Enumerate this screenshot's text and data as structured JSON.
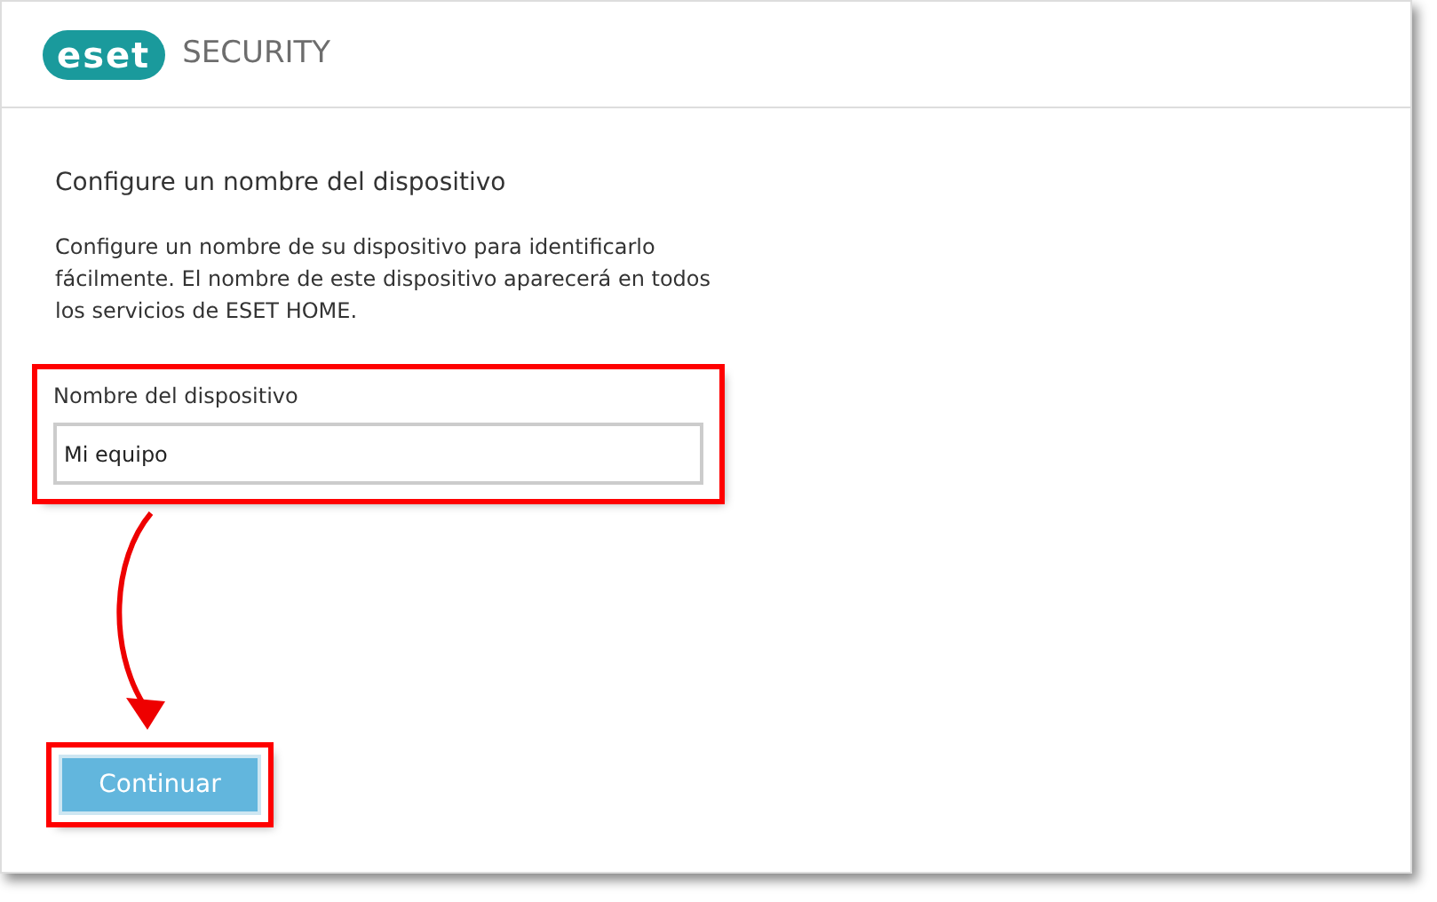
{
  "header": {
    "logo_text": "eset",
    "product": "SECURITY"
  },
  "heading": "Configure un nombre del dispositivo",
  "description": "Configure un nombre de su dispositivo para identificarlo fácilmente. El nombre de este dispositivo aparecerá en todos los servicios de ESET HOME.",
  "field": {
    "label": "Nombre del dispositivo",
    "value": "Mi equipo",
    "highlighted": true
  },
  "button": {
    "label": "Continuar",
    "highlighted": true
  },
  "arrow": true
}
